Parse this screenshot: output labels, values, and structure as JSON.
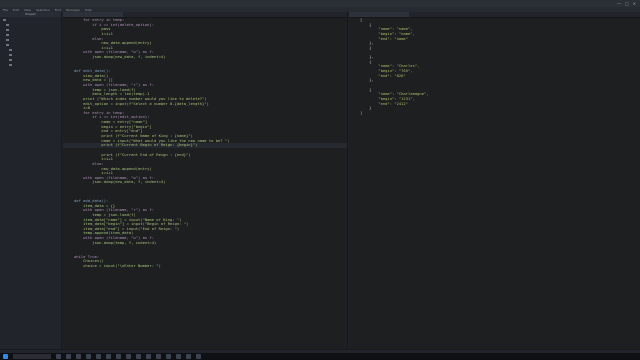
{
  "window": {
    "title": "",
    "controls": [
      "—",
      "□",
      "✕"
    ]
  },
  "menu": [
    "File",
    "Edit",
    "View",
    "Selection",
    "Find",
    "Packages",
    "Help"
  ],
  "sidebar": {
    "header": "Project",
    "items": [
      {
        "label": ""
      },
      {
        "label": ""
      },
      {
        "label": ""
      },
      {
        "label": ""
      },
      {
        "label": ""
      },
      {
        "label": ""
      },
      {
        "label": ""
      },
      {
        "label": ""
      },
      {
        "label": ""
      },
      {
        "label": ""
      }
    ]
  },
  "editor": {
    "tab_label": "",
    "lines": [
      {
        "n": "",
        "text": "    for entry in temp:",
        "cls": "kw"
      },
      {
        "n": "",
        "text": "        if i == int(delete_option):",
        "cls": "kw"
      },
      {
        "n": "",
        "text": "            pass",
        "cls": ""
      },
      {
        "n": "",
        "text": "            i=i+1",
        "cls": ""
      },
      {
        "n": "",
        "text": "        else:",
        "cls": "kw"
      },
      {
        "n": "",
        "text": "            new_data.append(entry)",
        "cls": ""
      },
      {
        "n": "",
        "text": "            i=i+1",
        "cls": ""
      },
      {
        "n": "",
        "text": "    with open (filename, \"w\") as f:",
        "cls": "kw"
      },
      {
        "n": "",
        "text": "        json.dump(new_data, f, indent=4)",
        "cls": ""
      },
      {
        "n": "",
        "text": "",
        "cls": ""
      },
      {
        "n": "",
        "text": "",
        "cls": ""
      },
      {
        "n": "",
        "text": "def edit_data():",
        "cls": "def"
      },
      {
        "n": "",
        "text": "    view_data()",
        "cls": ""
      },
      {
        "n": "",
        "text": "    new_data = []",
        "cls": ""
      },
      {
        "n": "",
        "text": "    with open (filename, \"r\") as f:",
        "cls": "kw"
      },
      {
        "n": "",
        "text": "        temp = json.load(f)",
        "cls": ""
      },
      {
        "n": "",
        "text": "        data_length = len(temp)-1",
        "cls": ""
      },
      {
        "n": "",
        "text": "    print (\"Which index number would you like to delete?\")",
        "cls": ""
      },
      {
        "n": "",
        "text": "    edit_option = input(f\"Select a number 0-{data_length}\")",
        "cls": ""
      },
      {
        "n": "",
        "text": "    i=0",
        "cls": ""
      },
      {
        "n": "",
        "text": "    for entry in temp:",
        "cls": "kw"
      },
      {
        "n": "",
        "text": "        if i == int(edit_option):",
        "cls": "kw"
      },
      {
        "n": "",
        "text": "            name = entry[\"name\"]",
        "cls": ""
      },
      {
        "n": "",
        "text": "            begin = entry[\"begin\"]",
        "cls": ""
      },
      {
        "n": "",
        "text": "            end = entry[\"end\"]",
        "cls": ""
      },
      {
        "n": "",
        "text": "            print (f\"Current Name of King : {name}\")",
        "cls": ""
      },
      {
        "n": "",
        "text": "            name = input(\"What would you like the new name to be? \")",
        "cls": ""
      },
      {
        "n": "",
        "text": "            print (f\"Current Begin of Reign: {begin}\")",
        "cls": "cur"
      },
      {
        "n": "",
        "text": "",
        "cls": ""
      },
      {
        "n": "",
        "text": "            print (f\"Current End of Reign : {end}\")",
        "cls": ""
      },
      {
        "n": "",
        "text": "            i=i+1",
        "cls": ""
      },
      {
        "n": "",
        "text": "        else:",
        "cls": "kw"
      },
      {
        "n": "",
        "text": "            new_data.append(entry)",
        "cls": ""
      },
      {
        "n": "",
        "text": "            i=i+1",
        "cls": ""
      },
      {
        "n": "",
        "text": "    with open (filename, \"w\") as f:",
        "cls": "kw"
      },
      {
        "n": "",
        "text": "        json.dump(new_data, f, indent=4)",
        "cls": ""
      },
      {
        "n": "",
        "text": "",
        "cls": ""
      },
      {
        "n": "",
        "text": "",
        "cls": ""
      },
      {
        "n": "",
        "text": "",
        "cls": ""
      },
      {
        "n": "",
        "text": "def add_data():",
        "cls": "def"
      },
      {
        "n": "",
        "text": "    item_data = {}",
        "cls": ""
      },
      {
        "n": "",
        "text": "    with open (filename, \"r\") as f:",
        "cls": "kw"
      },
      {
        "n": "",
        "text": "        temp = json.load(f)",
        "cls": ""
      },
      {
        "n": "",
        "text": "    item_data[\"name\"] = input(\"Name of King: \")",
        "cls": ""
      },
      {
        "n": "",
        "text": "    item_data[\"begin\"] = input(\"Begin of Reign: \")",
        "cls": ""
      },
      {
        "n": "",
        "text": "    item_data[\"end\"] = input(\"End of Reign: \")",
        "cls": ""
      },
      {
        "n": "",
        "text": "    temp.append(item_data)",
        "cls": ""
      },
      {
        "n": "",
        "text": "    with open (filename, \"w\") as f:",
        "cls": "kw"
      },
      {
        "n": "",
        "text": "        json.dump(temp, f, indent=4)",
        "cls": ""
      },
      {
        "n": "",
        "text": "",
        "cls": ""
      },
      {
        "n": "",
        "text": "",
        "cls": ""
      },
      {
        "n": "",
        "text": "while True:",
        "cls": "kw"
      },
      {
        "n": "",
        "text": "    Choices()",
        "cls": ""
      },
      {
        "n": "",
        "text": "    choice = input(\"\\nEnter Number: \")",
        "cls": ""
      }
    ]
  },
  "json_pane": {
    "tab_label": "",
    "lines": [
      {
        "text": "[",
        "cls": ""
      },
      {
        "text": "    {",
        "cls": ""
      },
      {
        "text": "        \"name\": \"name\",",
        "cls": "str"
      },
      {
        "text": "        \"begin\": \"name\",",
        "cls": "str"
      },
      {
        "text": "        \"end\": \"name\"",
        "cls": "str"
      },
      {
        "text": "    },",
        "cls": ""
      },
      {
        "text": "    {",
        "cls": ""
      },
      {
        "text": "",
        "cls": ""
      },
      {
        "text": "    },",
        "cls": ""
      },
      {
        "text": "    {",
        "cls": ""
      },
      {
        "text": "        \"name\": \"Charles\",",
        "cls": "str"
      },
      {
        "text": "        \"begin\": \"765\",",
        "cls": "str"
      },
      {
        "text": "        \"end\": \"820\"",
        "cls": "str"
      },
      {
        "text": "    },",
        "cls": ""
      },
      {
        "text": "",
        "cls": ""
      },
      {
        "text": "    {",
        "cls": ""
      },
      {
        "text": "        \"name\": \"Charlemagne\",",
        "cls": "str"
      },
      {
        "text": "        \"begin\": \"1231\",",
        "cls": "str"
      },
      {
        "text": "        \"end\": \"2412\"",
        "cls": "str"
      },
      {
        "text": "    }",
        "cls": ""
      },
      {
        "text": "]",
        "cls": ""
      }
    ]
  },
  "statusbar": {
    "left": "",
    "right": ""
  },
  "taskbar": {
    "search_placeholder": "",
    "icons": [
      "windows-icon",
      "task-view-icon",
      "edge-icon",
      "explorer-icon",
      "store-icon",
      "mail-icon",
      "chrome-icon",
      "atom-icon",
      "terminal-icon",
      "settings-icon",
      "python-icon",
      "app-icon",
      "app-icon",
      "app-icon",
      "app-icon",
      "app-icon"
    ],
    "tray_lang": "",
    "tray_time": "",
    "tray_date": ""
  }
}
